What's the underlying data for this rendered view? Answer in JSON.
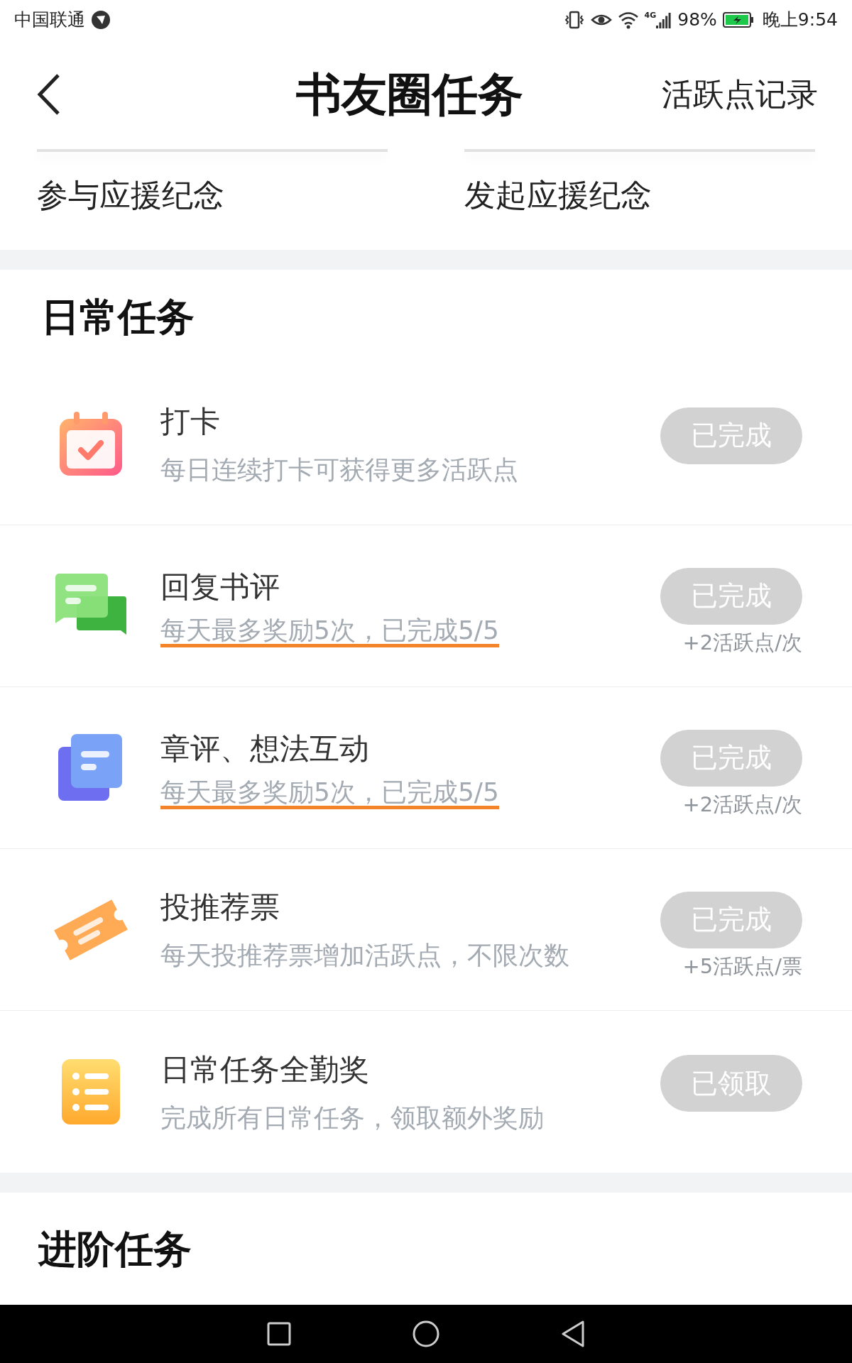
{
  "status_bar": {
    "carrier": "中国联通",
    "network": "4G",
    "battery": "98%",
    "time": "晚上9:54"
  },
  "header": {
    "title": "书友圈任务",
    "link": "活跃点记录"
  },
  "entries": [
    {
      "label": "参与应援纪念"
    },
    {
      "label": "发起应援纪念"
    }
  ],
  "daily": {
    "title": "日常任务",
    "tasks": [
      {
        "kind": "calendar",
        "title": "打卡",
        "desc": "每日连续打卡可获得更多活跃点",
        "highlighted": false,
        "button": "已完成",
        "completed": true
      },
      {
        "kind": "chat",
        "title": "回复书评",
        "desc": "每天最多奖励5次，已完成5/5",
        "highlighted": true,
        "button": "已完成",
        "completed": true,
        "reward": "+2活跃点/次"
      },
      {
        "kind": "note",
        "title": "章评、想法互动",
        "desc": "每天最多奖励5次，已完成5/5",
        "highlighted": true,
        "button": "已完成",
        "completed": true,
        "reward": "+2活跃点/次"
      },
      {
        "kind": "ticket",
        "title": "投推荐票",
        "desc": "每天投推荐票增加活跃点，不限次数",
        "highlighted": false,
        "button": "已完成",
        "completed": true,
        "reward": "+5活跃点/票"
      },
      {
        "kind": "list",
        "title": "日常任务全勤奖",
        "desc": "完成所有日常任务，领取额外奖励",
        "highlighted": false,
        "button": "已领取",
        "completed": true
      }
    ]
  },
  "advanced": {
    "title": "进阶任务"
  }
}
